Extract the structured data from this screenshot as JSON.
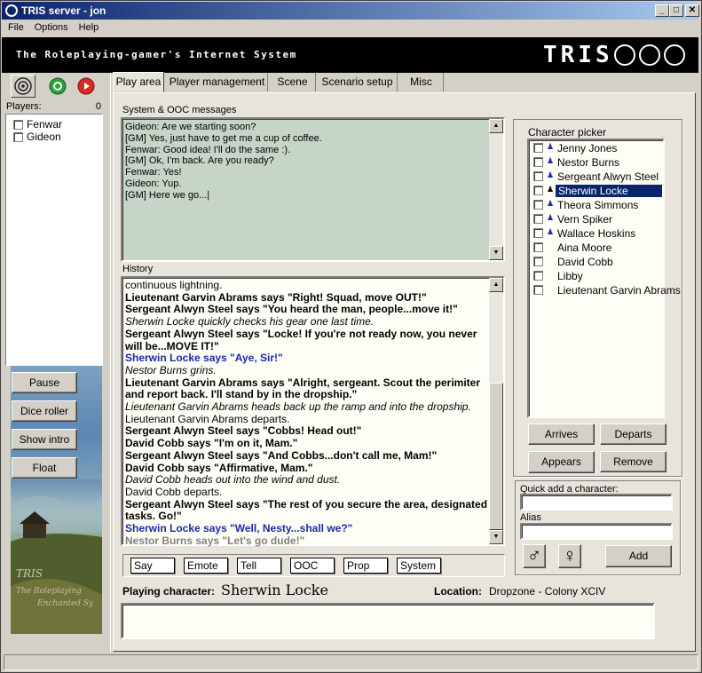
{
  "window": {
    "title": "TRIS server - jon",
    "min": "_",
    "max": "□",
    "close": "✕"
  },
  "menu": [
    "File",
    "Options",
    "Help"
  ],
  "banner": {
    "tagline": "The Roleplaying-gamer's Internet System",
    "logo": "TRIS"
  },
  "tabs": [
    "Play area",
    "Player management",
    "Scene",
    "Scenario setup",
    "Misc"
  ],
  "players": {
    "label": "Players:",
    "count": "0",
    "list": [
      "Fenwar",
      "Gideon"
    ]
  },
  "side_buttons": [
    "Pause",
    "Dice roller",
    "Show intro",
    "Float"
  ],
  "system": {
    "label": "System & OOC messages",
    "lines": [
      "Gideon: Are we starting soon?",
      "[GM] Yes, just have to get me a cup of coffee.",
      "Fenwar: Good idea! I'll do the same :).",
      "[GM] Ok, I'm back. Are you ready?",
      "Fenwar: Yes!",
      "Gideon: Yup.",
      "[GM] Here we go...|"
    ]
  },
  "history": {
    "label": "History",
    "lines": [
      {
        "t": "continuous lightning.",
        "s": ""
      },
      {
        "t": "Lieutenant Garvin Abrams says \"Right! Squad, move OUT!\"",
        "s": "b"
      },
      {
        "t": "Sergeant Alwyn Steel says \"You heard the man, people...move it!\"",
        "s": "b"
      },
      {
        "t": "Sherwin Locke quickly checks his gear one last time.",
        "s": "it"
      },
      {
        "t": "Sergeant Alwyn Steel says \"Locke! If you're not ready now, you never",
        "s": "b"
      },
      {
        "t": "will be...MOVE IT!\"",
        "s": "b"
      },
      {
        "t": "Sherwin Locke says \"Aye, Sir!\"",
        "s": "blue"
      },
      {
        "t": "Nestor Burns grins.",
        "s": "it"
      },
      {
        "t": "Lieutenant Garvin Abrams says \"Alright, sergeant. Scout the perimiter",
        "s": "b"
      },
      {
        "t": "and report back. I'll stand by in the dropship.\"",
        "s": "b"
      },
      {
        "t": "Lieutenant Garvin Abrams heads back up the ramp and into the dropship.",
        "s": "it"
      },
      {
        "t": "Lieutenant Garvin Abrams departs.",
        "s": ""
      },
      {
        "t": "Sergeant Alwyn Steel says \"Cobbs! Head out!\"",
        "s": "b"
      },
      {
        "t": "David Cobb says \"I'm on it, Mam.\"",
        "s": "b"
      },
      {
        "t": "Sergeant Alwyn Steel says \"And Cobbs...don't call me, Mam!\"",
        "s": "b"
      },
      {
        "t": "David Cobb says \"Affirmative, Mam.\"",
        "s": "b"
      },
      {
        "t": "David Cobb heads out into the wind and dust.",
        "s": "it"
      },
      {
        "t": "David Cobb departs.",
        "s": ""
      },
      {
        "t": "Sergeant Alwyn Steel says \"The rest of you secure the area, designated",
        "s": "b"
      },
      {
        "t": "tasks. Go!\"",
        "s": "b"
      },
      {
        "t": "Sherwin Locke says \"Well, Nesty...shall we?\"",
        "s": "blue"
      },
      {
        "t": "Nestor Burns says \"Let's go dude!\"",
        "s": "gray"
      }
    ]
  },
  "commands": [
    "Say",
    "Emote",
    "Tell",
    "OOC",
    "Prop",
    "System"
  ],
  "playing": {
    "label": "Playing character:",
    "name": "Sherwin Locke",
    "location_label": "Location:",
    "location": "Dropzone - Colony XCIV"
  },
  "picker": {
    "label": "Character picker",
    "characters": [
      {
        "name": "Jenny Jones",
        "player": true
      },
      {
        "name": "Nestor Burns",
        "player": true
      },
      {
        "name": "Sergeant Alwyn Steel",
        "player": true
      },
      {
        "name": "Sherwin Locke",
        "player": true,
        "selected": true
      },
      {
        "name": "Theora Simmons",
        "player": true
      },
      {
        "name": "Vern Spiker",
        "player": true
      },
      {
        "name": "Wallace Hoskins",
        "player": true
      },
      {
        "name": "Aina Moore",
        "player": false
      },
      {
        "name": "David Cobb",
        "player": false
      },
      {
        "name": "Libby",
        "player": false
      },
      {
        "name": "Lieutenant Garvin Abrams",
        "player": false
      }
    ],
    "buttons": [
      "Arrives",
      "Departs",
      "Appears",
      "Remove"
    ]
  },
  "quick_add": {
    "label": "Quick add a character:",
    "alias_label": "Alias",
    "male": "♂",
    "female": "♀",
    "add": "Add"
  }
}
